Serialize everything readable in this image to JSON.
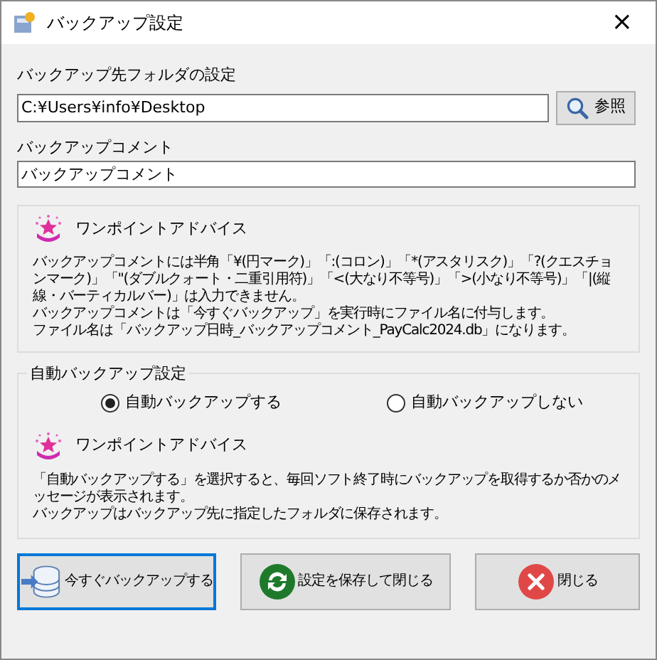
{
  "window": {
    "title": "バックアップ設定",
    "close": "×"
  },
  "folder": {
    "label": "バックアップ先フォルダの設定",
    "value": "C:¥Users¥info¥Desktop",
    "browse": "参照"
  },
  "comment": {
    "label": "バックアップコメント",
    "value": "バックアップコメント"
  },
  "advice_1": {
    "title": "ワンポイントアドバイス",
    "paragraphs": [
      "バックアップコメントには半角「¥(円マーク)」「:(コロン)」「*(アスタリスク)」「?(クエスチョンマーク)」「\"(ダブルクォート・二重引用符)」「<(大なり不等号)」「>(小なり不等号)」「|(縦線・バーティカルバー)」は入力できません。",
      "バックアップコメントは「今すぐバックアップ」を実行時にファイル名に付与します。",
      "ファイル名は「バックアップ日時_バックアップコメント_PayCalc2024.db」になります。"
    ]
  },
  "auto_backup": {
    "legend": "自動バックアップ設定",
    "options": [
      {
        "label": "自動バックアップする",
        "selected": true
      },
      {
        "label": "自動バックアップしない",
        "selected": false
      }
    ],
    "advice": {
      "title": "ワンポイントアドバイス",
      "paragraphs": [
        "「自動バックアップする」を選択すると、毎回ソフト終了時にバックアップを取得するか否かのメッセージが表示されます。",
        "バックアップはバックアップ先に指定したフォルダに保存されます。"
      ]
    }
  },
  "buttons": [
    {
      "kind": "backup",
      "label": "今すぐバックアップする",
      "focused": true
    },
    {
      "kind": "save",
      "label": "設定を保存して閉じる",
      "focused": false
    },
    {
      "kind": "close",
      "label": "閉じる",
      "focused": false
    }
  ]
}
